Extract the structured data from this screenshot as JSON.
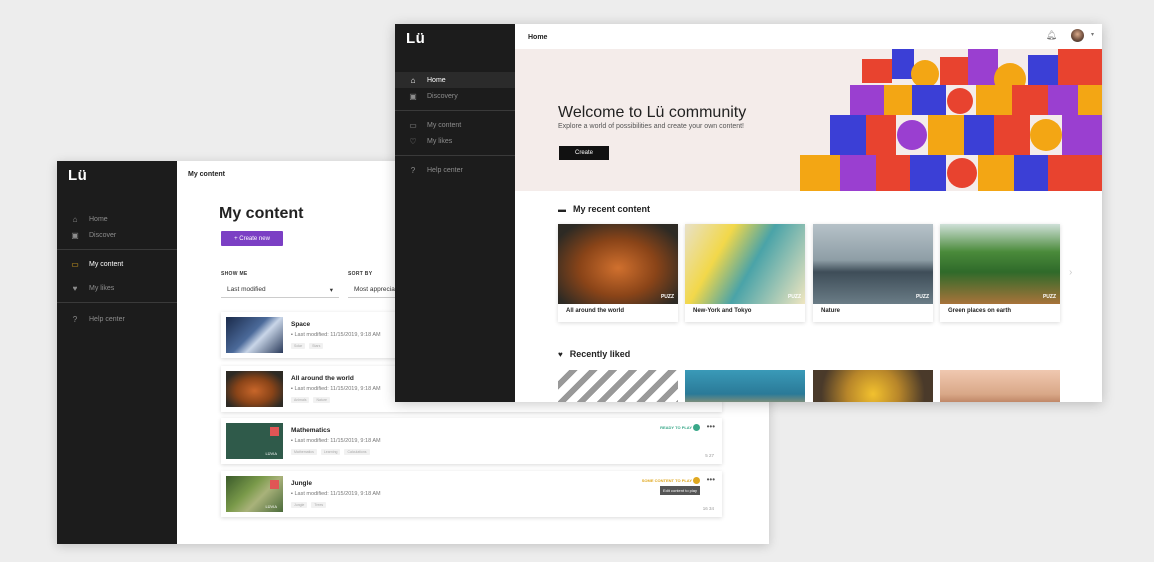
{
  "back_window": {
    "logo": "Lü",
    "topbar_title": "My content",
    "nav": [
      {
        "label": "Home",
        "icon": "home-icon"
      },
      {
        "label": "Discover",
        "icon": "discover-icon"
      },
      {
        "label": "My content",
        "icon": "folder-icon",
        "active": true
      },
      {
        "label": "My likes",
        "icon": "heart-icon"
      },
      {
        "label": "Help center",
        "icon": "help-icon"
      }
    ],
    "page_title": "My content",
    "create_button": "+ Create new",
    "show_me_label": "SHOW ME",
    "show_me_value": "Last modified",
    "sort_by_label": "SORT BY",
    "sort_by_value": "Most apprecia",
    "items": [
      {
        "title": "Space",
        "meta": "Last modified: 11/15/2019, 9:18 AM",
        "tags": [
          "Solar",
          "Stars"
        ]
      },
      {
        "title": "All around the world",
        "meta": "Last modified: 11/15/2019, 9:18 AM",
        "tags": [
          "Animals",
          "Nature"
        ]
      },
      {
        "title": "Mathematics",
        "meta": "Last modified: 11/15/2019, 9:18 AM",
        "tags": [
          "Mathematics",
          "Learning",
          "Calculations"
        ],
        "status": "READY TO PLAY",
        "stats": "5   27"
      },
      {
        "title": "Jungle",
        "meta": "Last modified: 11/15/2019, 9:18 AM",
        "tags": [
          "Jungle",
          "Trees"
        ],
        "status": "SOME CONTENT TO PLAY",
        "tooltip": "Edit content to play",
        "stats": "16   34"
      }
    ],
    "thumb_label": "LÜVIA"
  },
  "front_window": {
    "logo": "Lü",
    "topbar_title": "Home",
    "nav": [
      {
        "label": "Home",
        "icon": "home-icon",
        "active": true
      },
      {
        "label": "Discovery",
        "icon": "discover-icon"
      },
      {
        "label": "My content",
        "icon": "folder-icon"
      },
      {
        "label": "My likes",
        "icon": "heart-icon"
      },
      {
        "label": "Help center",
        "icon": "help-icon"
      }
    ],
    "hero_title": "Welcome to Lü community",
    "hero_subtitle": "Explore a world of possibilities and create your own content!",
    "hero_button": "Create",
    "recent_title": "My recent content",
    "recent_items": [
      {
        "caption": "All around the world",
        "badge": "PUZZ"
      },
      {
        "caption": "New-York and Tokyo",
        "badge": "PUZZ"
      },
      {
        "caption": "Nature",
        "badge": "PUZZ"
      },
      {
        "caption": "Green places on earth",
        "badge": "PUZZ"
      }
    ],
    "liked_title": "Recently liked"
  },
  "colors": {
    "accent": "#7b3fc4",
    "sidebar": "#1c1c1c",
    "ready": "#3aa889",
    "warning": "#e0a820"
  }
}
